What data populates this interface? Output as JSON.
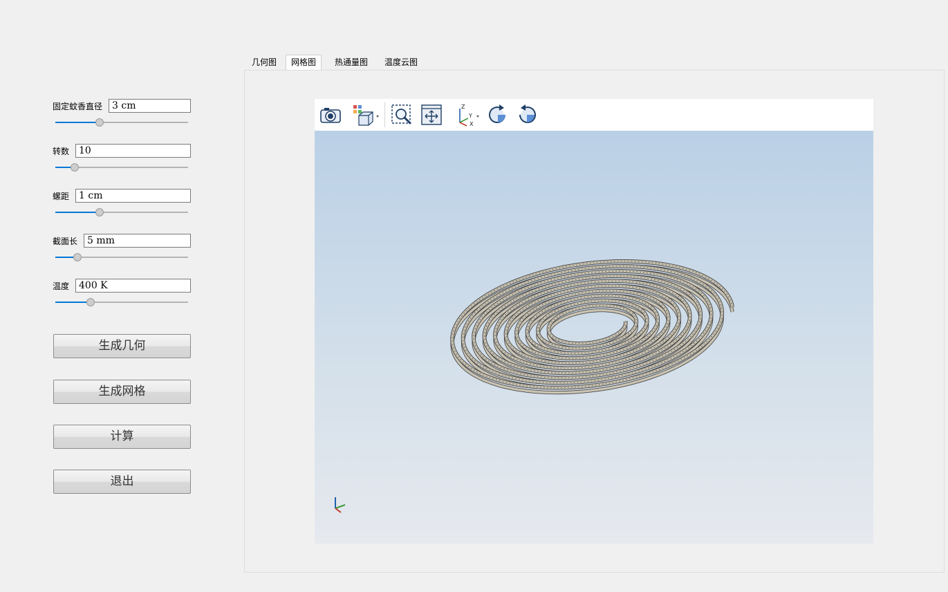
{
  "params": [
    {
      "label": "固定蚊香直径",
      "value": "3 cm",
      "slider_fraction": 0.33
    },
    {
      "label": "转数",
      "value": "10",
      "slider_fraction": 0.14
    },
    {
      "label": "螺距",
      "value": "1 cm",
      "slider_fraction": 0.33
    },
    {
      "label": "截面长",
      "value": "5 mm",
      "slider_fraction": 0.16
    },
    {
      "label": "温度",
      "value": "400 K",
      "slider_fraction": 0.26
    }
  ],
  "buttons": {
    "generate_geometry": "生成几何",
    "generate_mesh": "生成网格",
    "compute": "计算",
    "exit": "退出"
  },
  "tabs": [
    "几何图",
    "网格图",
    "热通量图",
    "温度云图"
  ],
  "active_tab": "网格图",
  "toolbar_icons": [
    "camera-icon",
    "view-cube-icon",
    "zoom-box-icon",
    "zoom-extents-icon",
    "axes-orientation-icon",
    "rotate-cw-icon",
    "rotate-ccw-icon"
  ],
  "axis_triad": {
    "x": "X",
    "y": "Y",
    "z": "Z"
  },
  "colors": {
    "accent": "#0078d7",
    "scene_top": "#bad0e6",
    "scene_bottom": "#e6e9ee",
    "mesh_fill": "#c9c3b3",
    "mesh_line": "#4a4a4a"
  }
}
